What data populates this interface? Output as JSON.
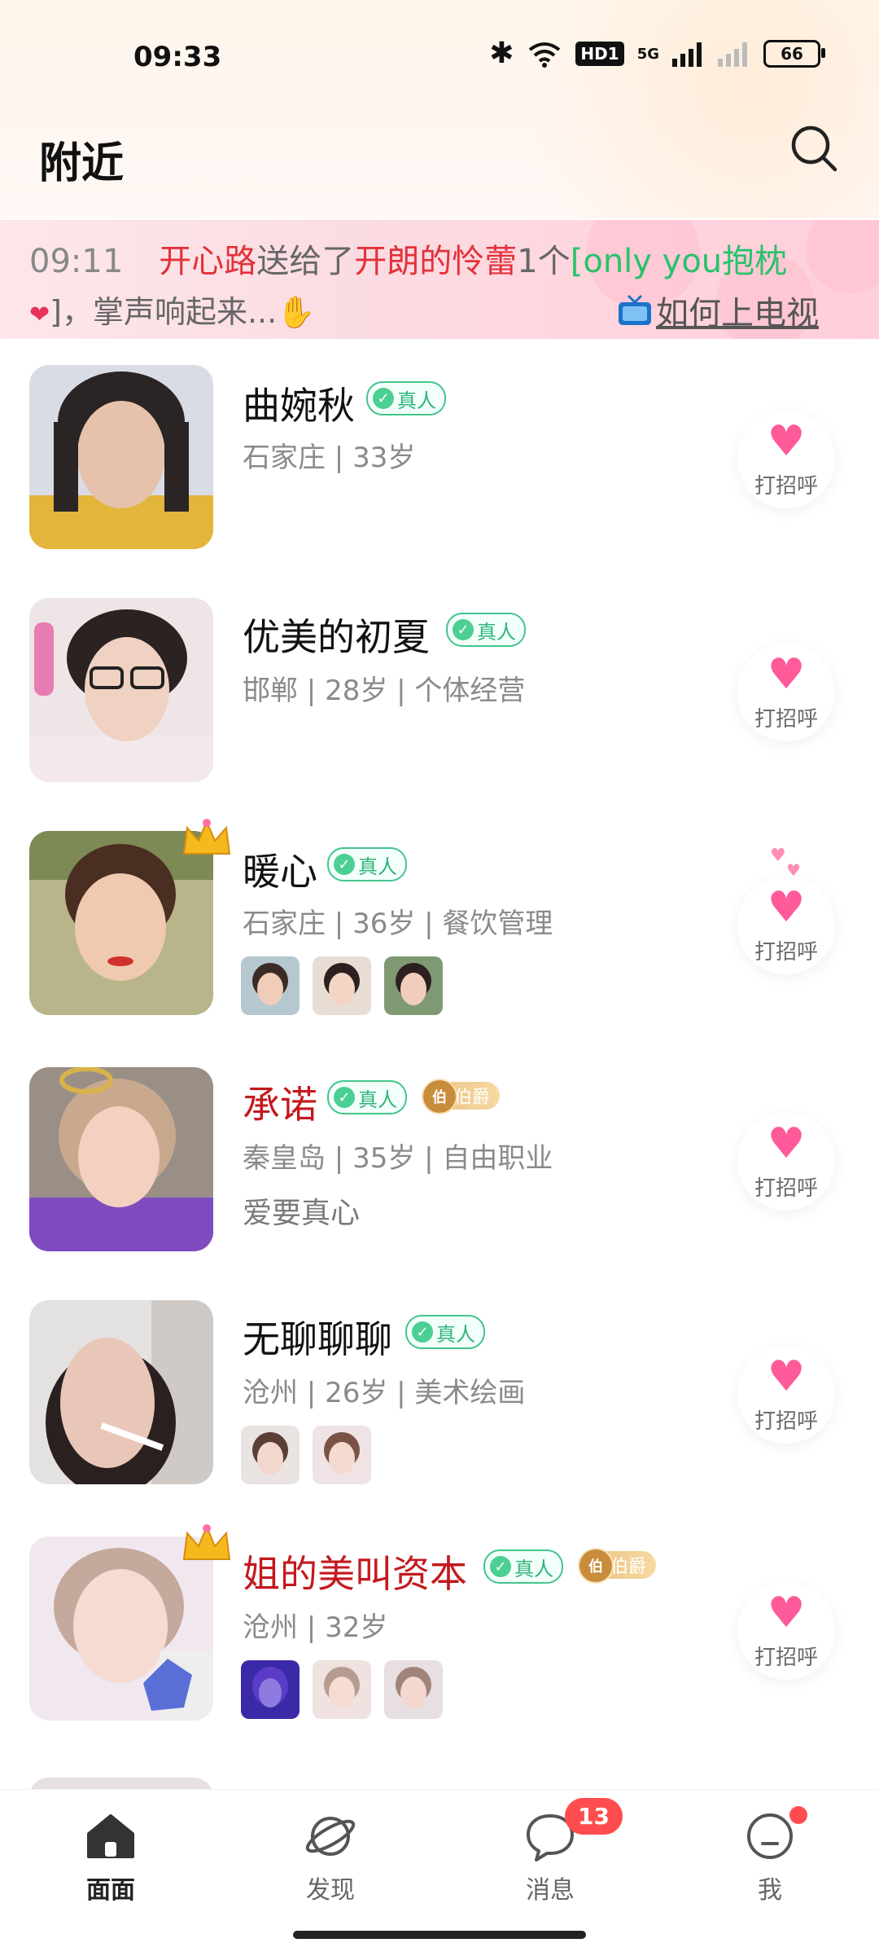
{
  "status_bar": {
    "time": "09:33",
    "hd": "HD1",
    "net": "5G",
    "battery": "66"
  },
  "header": {
    "title": "附近"
  },
  "notice": {
    "time": "09:11",
    "sender": "开心路",
    "verb": "送给了",
    "receiver": "开朗的怜蕾",
    "count": "1个",
    "gift": "[only you抱枕",
    "gift_close": "]，掌声响起来...",
    "tv_link": "如何上电视"
  },
  "verified_label": "真人",
  "greet_label": "打招呼",
  "users": [
    {
      "name": "曲婉秋",
      "meta": "石家庄 | 33岁",
      "vip": false
    },
    {
      "name": "优美的初夏",
      "meta": "邯郸 | 28岁 | 个体经营",
      "vip": false
    },
    {
      "name": "暖心",
      "meta": "石家庄 | 36岁 | 餐饮管理",
      "vip": false
    },
    {
      "name": "承诺",
      "meta": "秦皇岛 | 35岁 | 自由职业",
      "signature": "爱要真心",
      "rank": "伯爵",
      "vip": true
    },
    {
      "name": "无聊聊聊",
      "meta": "沧州 | 26岁 | 美术绘画",
      "vip": false
    },
    {
      "name": "姐的美叫资本",
      "meta": "沧州 | 32岁",
      "rank": "伯爵",
      "vip": true
    }
  ],
  "bottom_nav": {
    "items": [
      {
        "label": "面面"
      },
      {
        "label": "发现"
      },
      {
        "label": "消息",
        "badge": "13"
      },
      {
        "label": "我"
      }
    ]
  },
  "colors": {
    "accent_pink": "#ff5a9a",
    "verified_green": "#43c58d",
    "vip_red": "#c3191e",
    "badge_red": "#ff4d4f"
  }
}
